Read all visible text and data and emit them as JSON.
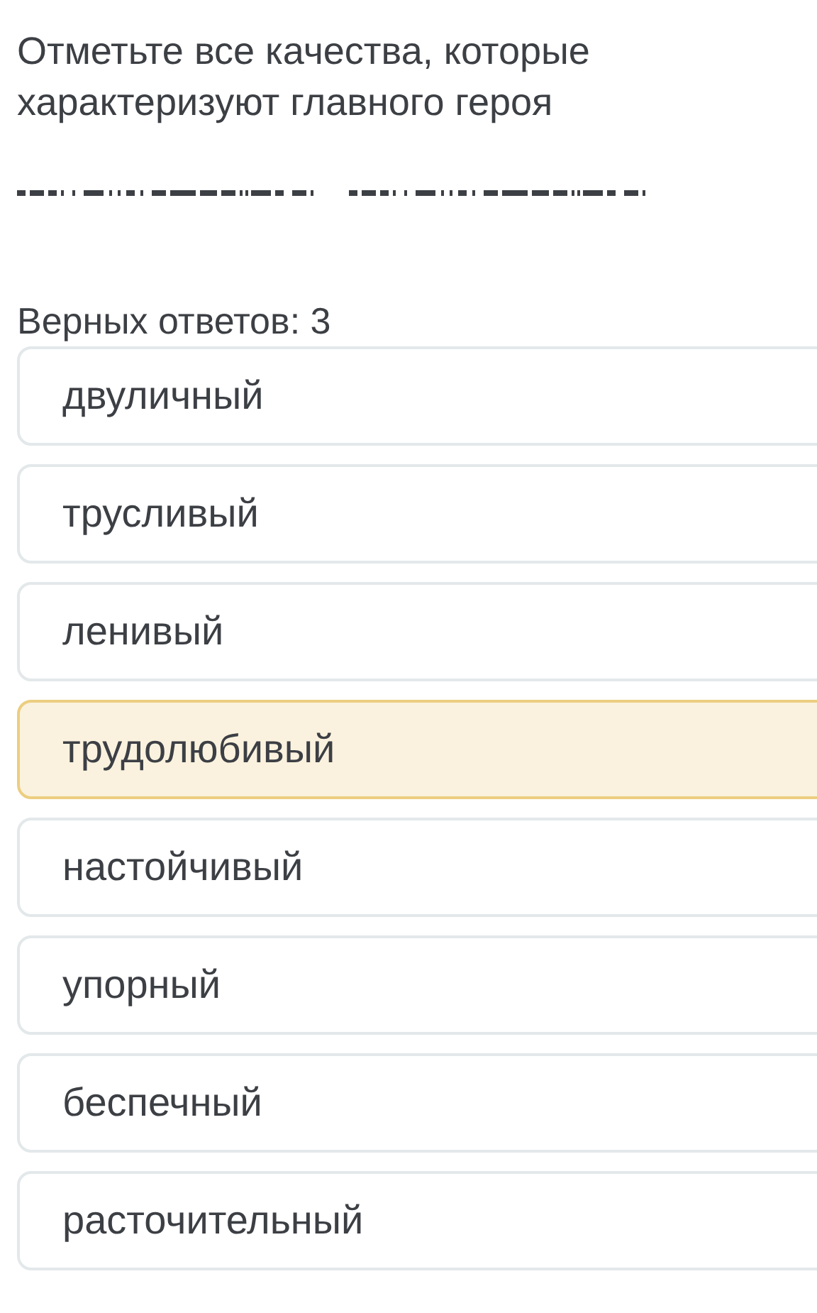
{
  "question": "Отметьте все качества, которые характеризуют главного героя",
  "answer_count": "Верных ответов: 3",
  "options": [
    {
      "label": "двуличный",
      "selected": false
    },
    {
      "label": "трусливый",
      "selected": false
    },
    {
      "label": "ленивый",
      "selected": false
    },
    {
      "label": "трудолюбивый",
      "selected": true
    },
    {
      "label": "настойчивый",
      "selected": false
    },
    {
      "label": "упорный",
      "selected": false
    },
    {
      "label": "беспечный",
      "selected": false
    },
    {
      "label": "расточительный",
      "selected": false
    }
  ]
}
